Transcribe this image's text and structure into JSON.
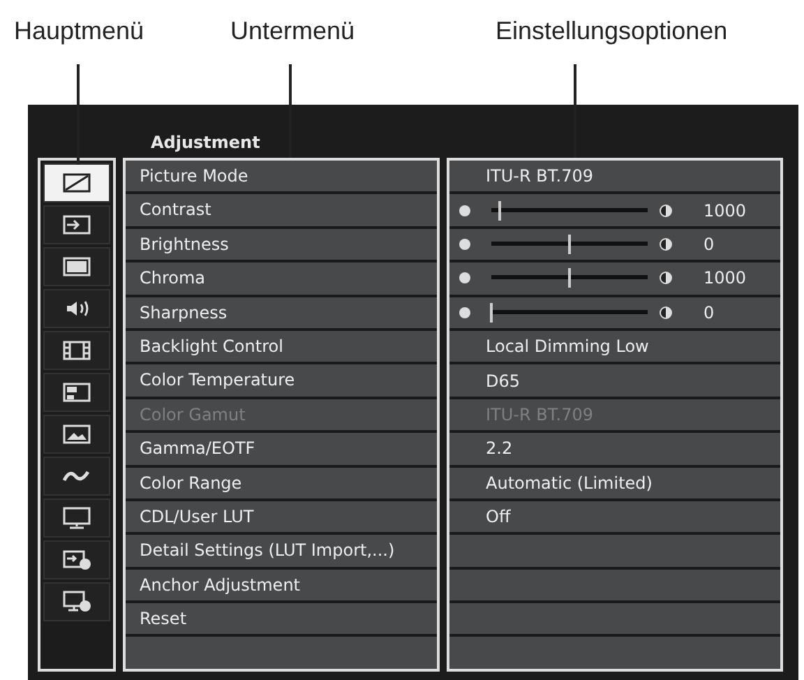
{
  "callouts": [
    {
      "label": "Hauptmenü"
    },
    {
      "label": "Untermenü"
    },
    {
      "label": "Einstellungsoptionen"
    }
  ],
  "menu_title": "Adjustment",
  "main_menu": [
    {
      "kind": "picture",
      "selected": true
    },
    {
      "kind": "input",
      "selected": false
    },
    {
      "kind": "screen",
      "selected": false
    },
    {
      "kind": "speaker",
      "selected": false
    },
    {
      "kind": "film",
      "selected": false
    },
    {
      "kind": "layout",
      "selected": false
    },
    {
      "kind": "image",
      "selected": false
    },
    {
      "kind": "wave",
      "selected": false
    },
    {
      "kind": "monitor",
      "selected": false
    },
    {
      "kind": "input-info",
      "selected": false
    },
    {
      "kind": "monitor-info",
      "selected": false
    }
  ],
  "submenu": [
    {
      "label": "Picture Mode",
      "disabled": false
    },
    {
      "label": "Contrast",
      "disabled": false
    },
    {
      "label": "Brightness",
      "disabled": false
    },
    {
      "label": "Chroma",
      "disabled": false
    },
    {
      "label": "Sharpness",
      "disabled": false
    },
    {
      "label": "Backlight Control",
      "disabled": false
    },
    {
      "label": "Color Temperature",
      "disabled": false
    },
    {
      "label": "Color Gamut",
      "disabled": true
    },
    {
      "label": "Gamma/EOTF",
      "disabled": false
    },
    {
      "label": "Color Range",
      "disabled": false
    },
    {
      "label": "CDL/User LUT",
      "disabled": false
    },
    {
      "label": "Detail Settings (LUT Import,...)",
      "disabled": false
    },
    {
      "label": "Anchor Adjustment",
      "disabled": false
    },
    {
      "label": "Reset",
      "disabled": false
    }
  ],
  "options": [
    {
      "kind": "text",
      "value": "ITU-R BT.709",
      "disabled": false
    },
    {
      "kind": "slider",
      "level": 0.05,
      "reading": "1000"
    },
    {
      "kind": "slider",
      "level": 0.5,
      "reading": "0"
    },
    {
      "kind": "slider",
      "level": 0.5,
      "reading": "1000"
    },
    {
      "kind": "slider",
      "level": 0.0,
      "reading": "0"
    },
    {
      "kind": "text",
      "value": "Local Dimming Low",
      "disabled": false
    },
    {
      "kind": "text",
      "value": "D65",
      "disabled": false
    },
    {
      "kind": "text",
      "value": "ITU-R BT.709",
      "disabled": true
    },
    {
      "kind": "text",
      "value": "2.2",
      "disabled": false
    },
    {
      "kind": "text",
      "value": "Automatic (Limited)",
      "disabled": false
    },
    {
      "kind": "text",
      "value": "Off",
      "disabled": false
    }
  ]
}
